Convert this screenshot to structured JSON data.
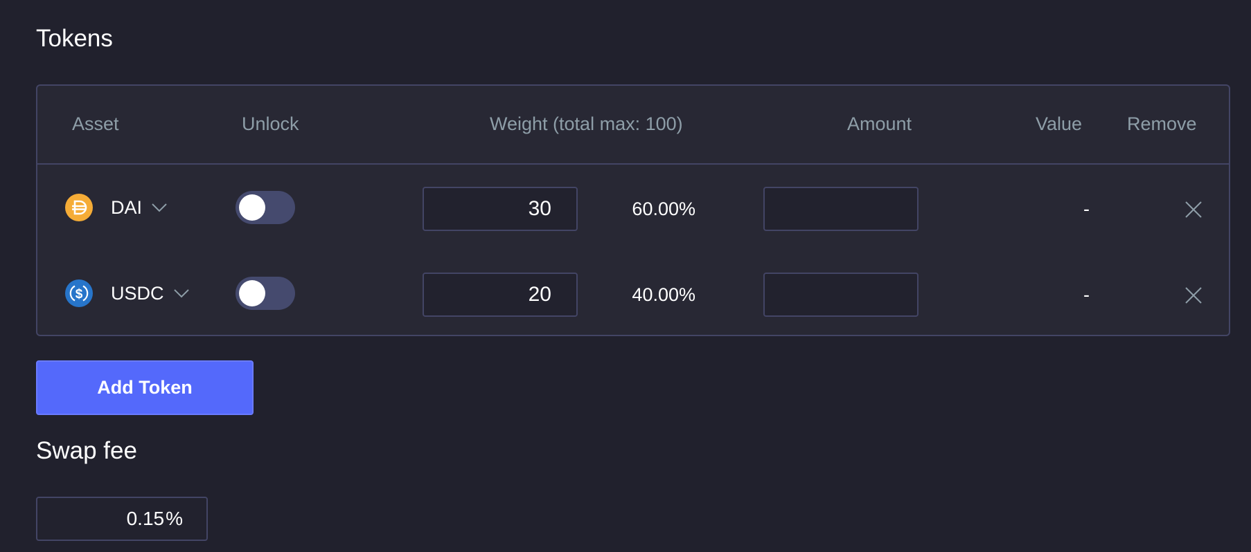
{
  "tokens_section": {
    "title": "Tokens",
    "columns": {
      "asset": "Asset",
      "unlock": "Unlock",
      "weight": "Weight (total max: 100)",
      "amount": "Amount",
      "value": "Value",
      "remove": "Remove"
    },
    "rows": [
      {
        "symbol": "DAI",
        "icon": "dai-icon",
        "icon_color": "#f5ac37",
        "unlocked": false,
        "weight": "30",
        "weight_percent": "60.00%",
        "amount": "",
        "value": "-"
      },
      {
        "symbol": "USDC",
        "icon": "usdc-icon",
        "icon_color": "#2775ca",
        "unlocked": false,
        "weight": "20",
        "weight_percent": "40.00%",
        "amount": "",
        "value": "-"
      }
    ],
    "add_token_label": "Add Token"
  },
  "swap_fee_section": {
    "title": "Swap fee",
    "value": "0.15",
    "unit": "%"
  },
  "colors": {
    "background": "#21212d",
    "panel": "#282834",
    "border": "#434565",
    "accent_button": "#5469fb",
    "toggle_off": "#454a6e",
    "muted_text": "#8e9ea8"
  }
}
